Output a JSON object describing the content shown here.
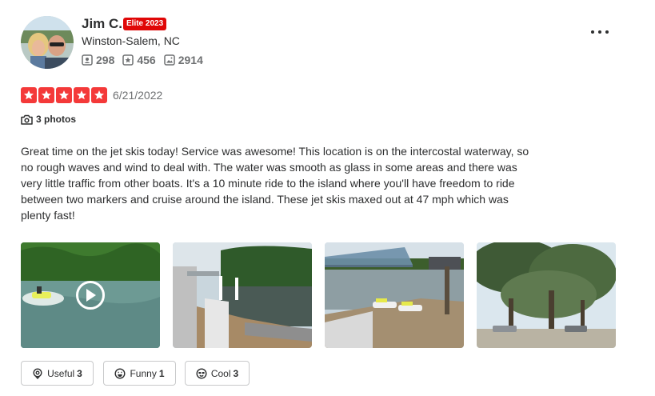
{
  "user": {
    "name": "Jim C.",
    "elite_badge": "Elite 2023",
    "location": "Winston-Salem, NC",
    "stats": [
      {
        "icon": "friends-icon",
        "count": "298"
      },
      {
        "icon": "reviews-star-icon",
        "count": "456"
      },
      {
        "icon": "photos-icon",
        "count": "2914"
      }
    ]
  },
  "review": {
    "stars": 5,
    "star_color": "#f43939",
    "date": "6/21/2022",
    "photos_label": "3 photos",
    "text": "Great time on the jet skis today! Service was awesome! This location is on the intercostal waterway, so no rough waves and wind to deal with. The water was smooth as glass in some areas and there was very little traffic from other boats. It's a 10 minute ride to the island where you'll have freedom to ride between two markers and cruise around the island. These jet skis maxed out at 47 mph which was plenty fast!"
  },
  "media": [
    {
      "kind": "video",
      "subject": "jet ski on river"
    },
    {
      "kind": "photo",
      "subject": "dock with covered slips"
    },
    {
      "kind": "photo",
      "subject": "jet skis at floating dock near bridge"
    },
    {
      "kind": "photo",
      "subject": "live oak trees with spanish moss"
    }
  ],
  "reactions": [
    {
      "icon": "lightbulb-icon",
      "label": "Useful",
      "count": "3"
    },
    {
      "icon": "laugh-icon",
      "label": "Funny",
      "count": "1"
    },
    {
      "icon": "cool-icon",
      "label": "Cool",
      "count": "3"
    }
  ],
  "colors": {
    "brand_red": "#e00707",
    "text": "#2d2e2f",
    "muted": "#6e7072",
    "border": "#c8c9ca"
  }
}
